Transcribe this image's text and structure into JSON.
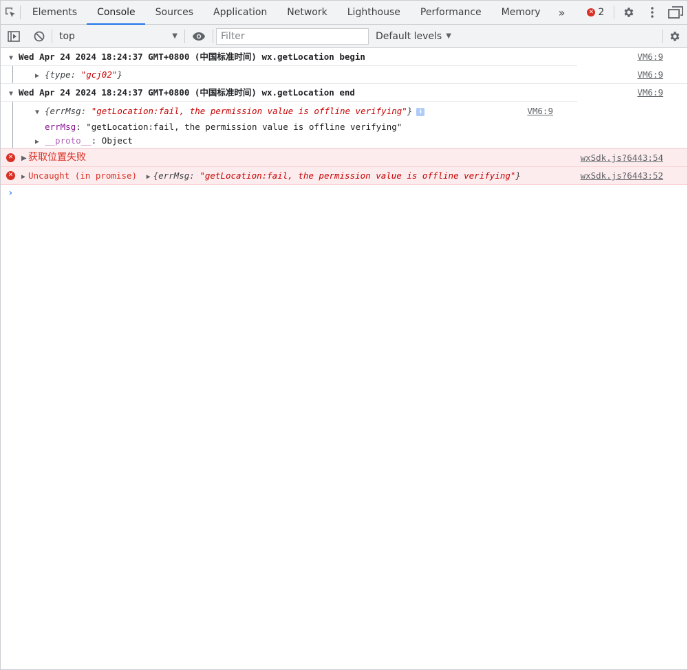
{
  "tabs": [
    {
      "label": "Elements"
    },
    {
      "label": "Console"
    },
    {
      "label": "Sources"
    },
    {
      "label": "Application"
    },
    {
      "label": "Network"
    },
    {
      "label": "Lighthouse"
    },
    {
      "label": "Performance"
    },
    {
      "label": "Memory"
    }
  ],
  "active_tab": "Console",
  "more_tabs_glyph": "»",
  "error_count": "2",
  "toolbar": {
    "context": "top",
    "filter_placeholder": "Filter",
    "levels": "Default levels"
  },
  "log": {
    "m1": {
      "text": "Wed Apr 24 2024 18:24:37 GMT+0800 (中国标准时间) wx.getLocation begin",
      "source": "VM6:9",
      "obj_key": "type",
      "obj_val": "\"gcj02\"",
      "obj_source": "VM6:9"
    },
    "m2": {
      "text": "Wed Apr 24 2024 18:24:37 GMT+0800 (中国标准时间) wx.getLocation end",
      "source": "VM6:9",
      "obj_key": "errMsg",
      "obj_val": "\"getLocation:fail, the permission value is offline verifying\"",
      "obj_source": "VM6:9",
      "prop_key": "errMsg",
      "prop_val": "\"getLocation:fail, the permission value is offline verifying\"",
      "proto_key": "__proto__",
      "proto_val": "Object"
    },
    "e1": {
      "text": "获取位置失败",
      "source": "wxSdk.js?6443:54"
    },
    "e2": {
      "prefix": "Uncaught (in promise)",
      "obj_key": "errMsg",
      "obj_val": "\"getLocation:fail, the permission value is offline verifying\"",
      "source": "wxSdk.js?6443:52"
    }
  },
  "colors": {
    "accent": "#1a73e8",
    "error": "#d93025",
    "error_bg": "#fdeced",
    "string": "#c80000",
    "key": "#881391"
  },
  "icons": [
    "inspect-icon",
    "device-toggle-icon",
    "clear-console-icon",
    "eye-icon",
    "gear-icon",
    "kebab-menu-icon",
    "dock-icon",
    "error-icon",
    "info-icon",
    "prompt-icon"
  ]
}
